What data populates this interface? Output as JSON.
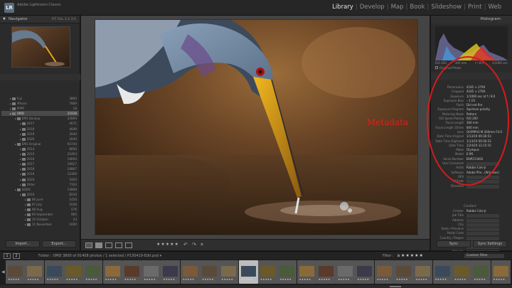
{
  "app": {
    "badge": "LR",
    "title": "Adobe Lightroom Classic"
  },
  "modules": [
    {
      "label": "Library",
      "active": true
    },
    {
      "label": "Develop",
      "active": false
    },
    {
      "label": "Map",
      "active": false
    },
    {
      "label": "Book",
      "active": false
    },
    {
      "label": "Slideshow",
      "active": false
    },
    {
      "label": "Print",
      "active": false
    },
    {
      "label": "Web",
      "active": false
    }
  ],
  "navigator": {
    "title": "Navigator",
    "zoom": "FIT  FILL  1:1  3:1"
  },
  "folders": [
    {
      "name": "Fuji",
      "count": "3800",
      "level": 1
    },
    {
      "name": "iPhone",
      "count": "7869",
      "level": 1
    },
    {
      "name": "PPPP",
      "count": "18",
      "level": 1
    },
    {
      "name": "OMD",
      "count": "31938",
      "level": 1,
      "selected": true
    },
    {
      "name": "EM1 Backup",
      "count": "22894",
      "level": 2
    },
    {
      "name": "2017",
      "count": "4671",
      "level": 3
    },
    {
      "name": "2018",
      "count": "4649",
      "level": 3
    },
    {
      "name": "2019",
      "count": "2640",
      "level": 3
    },
    {
      "name": "2020",
      "count": "2640",
      "level": 3
    },
    {
      "name": "EM1 Original",
      "count": "93744",
      "level": 2
    },
    {
      "name": "2014",
      "count": "8856",
      "level": 3
    },
    {
      "name": "2015",
      "count": "21463",
      "level": 3
    },
    {
      "name": "2016",
      "count": "19604",
      "level": 3
    },
    {
      "name": "2017",
      "count": "19427",
      "level": 3
    },
    {
      "name": "2018",
      "count": "10867",
      "level": 3
    },
    {
      "name": "2019",
      "count": "12369",
      "level": 3
    },
    {
      "name": "2020",
      "count": "5464",
      "level": 3
    },
    {
      "name": "Older",
      "count": "7163",
      "level": 3
    },
    {
      "name": "SDDX",
      "count": "14808",
      "level": 2
    },
    {
      "name": "2019",
      "count": "8220",
      "level": 3
    },
    {
      "name": "06 June",
      "count": "1450",
      "level": 4
    },
    {
      "name": "07 July",
      "count": "2036",
      "level": 4
    },
    {
      "name": "08 Aug",
      "count": "576",
      "level": 4
    },
    {
      "name": "09 September",
      "count": "965",
      "level": 4
    },
    {
      "name": "10 October",
      "count": "23",
      "level": 4
    },
    {
      "name": "11 November",
      "count": "1600",
      "level": 4
    }
  ],
  "left_buttons": {
    "import": "Import...",
    "export": "Export..."
  },
  "histogram": {
    "title": "Histogram",
    "info": [
      "ISO 200",
      "300 mm",
      "f / 8.0",
      "1/1000 sec"
    ],
    "original": "Original Photo"
  },
  "metadata_label": "Metadata",
  "metadata": [
    {
      "label": "Dimensions",
      "value": "4185 × 2790"
    },
    {
      "label": "Cropped",
      "value": "4185 × 2790"
    },
    {
      "label": "Exposure",
      "value": "1/1000 sec at f / 8.0"
    },
    {
      "label": "Exposure Bias",
      "value": "– 1 EV"
    },
    {
      "label": "Flash",
      "value": "Did not fire"
    },
    {
      "label": "Exposure Program",
      "value": "Aperture priority"
    },
    {
      "label": "Metering Mode",
      "value": "Pattern"
    },
    {
      "label": "ISO Speed Rating",
      "value": "ISO 200"
    },
    {
      "label": "Focal Length",
      "value": "300 mm"
    },
    {
      "label": "Focal Length 35mm",
      "value": "600 mm"
    },
    {
      "label": "Lens",
      "value": "OLYMPUS M.300mm F4.0"
    },
    {
      "label": "Date Time Original",
      "value": "1/13/19 09:36:53"
    },
    {
      "label": "Date Time Digitized",
      "value": "1/13/19 09:36:53"
    },
    {
      "label": "Date Time",
      "value": "1/24/19 12:15:15"
    },
    {
      "label": "Make",
      "value": "Olympus"
    },
    {
      "label": "Model",
      "value": "E-M1"
    },
    {
      "label": "Serial Number",
      "value": "BHP213402"
    },
    {
      "label": "User Comment",
      "value": ""
    },
    {
      "label": "Artist",
      "value": "Robbie Cole Jr"
    },
    {
      "label": "Software",
      "value": "Adobe Pho...(Windows)"
    },
    {
      "label": "GPS",
      "value": ""
    },
    {
      "label": "Altitude",
      "value": ""
    },
    {
      "label": "Direction",
      "value": ""
    }
  ],
  "contact": {
    "title": "Contact",
    "rows": [
      {
        "label": "Creator",
        "value": "Robbie Cole Jr"
      },
      {
        "label": "Job Title",
        "value": ""
      },
      {
        "label": "Address",
        "value": ""
      },
      {
        "label": "City",
        "value": ""
      },
      {
        "label": "State / Province",
        "value": ""
      },
      {
        "label": "Postal Code",
        "value": ""
      },
      {
        "label": "Country / Region",
        "value": ""
      },
      {
        "label": "Phone",
        "value": ""
      },
      {
        "label": "E-Mail",
        "value": ""
      },
      {
        "label": "Website",
        "value": ""
      }
    ]
  },
  "right_buttons": {
    "sync": "Sync",
    "sync_settings": "Sync Settings"
  },
  "toolbar": {
    "stars": "★★★★★"
  },
  "filter": {
    "pages": [
      "1",
      "2"
    ],
    "path": "Folder : OMD   3800 of 91408 photos / 1 selected / P130419-Edit.psd ▾",
    "label": "Filter :",
    "stars": "≥★★★★★",
    "custom": "Custom Filter"
  },
  "filmstrip_stars": "★★★★★"
}
